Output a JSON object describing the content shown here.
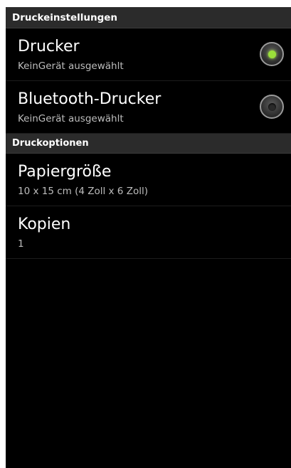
{
  "sections": [
    {
      "header": "Druckeinstellungen",
      "items": [
        {
          "title": "Drucker",
          "summary": "KeinGerät ausgewählt",
          "checked": true
        },
        {
          "title": "Bluetooth-Drucker",
          "summary": "KeinGerät ausgewählt",
          "checked": false
        }
      ]
    },
    {
      "header": "Druckoptionen",
      "items": [
        {
          "title": "Papiergröße",
          "summary": "10 x 15 cm (4 Zoll x 6 Zoll)"
        },
        {
          "title": "Kopien",
          "summary": "1"
        }
      ]
    }
  ],
  "colors": {
    "background": "#000000",
    "header_background": "#2b2b2b",
    "radio_checked": "#9be03a"
  }
}
